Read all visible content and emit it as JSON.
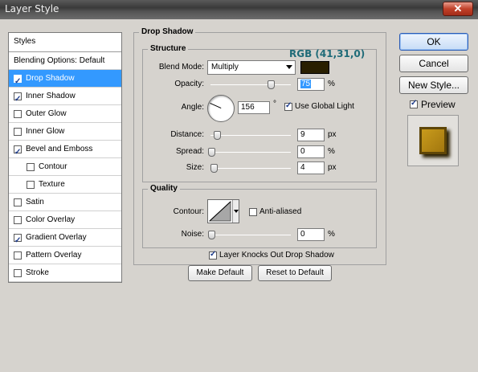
{
  "window": {
    "title": "Layer Style",
    "close_label": "✕"
  },
  "styles_list": {
    "header": "Styles",
    "items": [
      {
        "label": "Blending Options: Default",
        "checkbox": false,
        "checked": false,
        "selected": false,
        "indent": false
      },
      {
        "label": "Drop Shadow",
        "checkbox": true,
        "checked": true,
        "selected": true,
        "indent": false
      },
      {
        "label": "Inner Shadow",
        "checkbox": true,
        "checked": true,
        "selected": false,
        "indent": false
      },
      {
        "label": "Outer Glow",
        "checkbox": true,
        "checked": false,
        "selected": false,
        "indent": false
      },
      {
        "label": "Inner Glow",
        "checkbox": true,
        "checked": false,
        "selected": false,
        "indent": false
      },
      {
        "label": "Bevel and Emboss",
        "checkbox": true,
        "checked": true,
        "selected": false,
        "indent": false
      },
      {
        "label": "Contour",
        "checkbox": true,
        "checked": false,
        "selected": false,
        "indent": true
      },
      {
        "label": "Texture",
        "checkbox": true,
        "checked": false,
        "selected": false,
        "indent": true
      },
      {
        "label": "Satin",
        "checkbox": true,
        "checked": false,
        "selected": false,
        "indent": false
      },
      {
        "label": "Color Overlay",
        "checkbox": true,
        "checked": false,
        "selected": false,
        "indent": false
      },
      {
        "label": "Gradient Overlay",
        "checkbox": true,
        "checked": true,
        "selected": false,
        "indent": false
      },
      {
        "label": "Pattern Overlay",
        "checkbox": true,
        "checked": false,
        "selected": false,
        "indent": false
      },
      {
        "label": "Stroke",
        "checkbox": true,
        "checked": false,
        "selected": false,
        "indent": false
      }
    ]
  },
  "drop_shadow": {
    "title": "Drop Shadow",
    "structure": {
      "title": "Structure",
      "color_annotation": "RGB (41,31,0)",
      "shadow_color": "#291f00",
      "blend_mode_label": "Blend Mode:",
      "blend_mode_value": "Multiply",
      "opacity_label": "Opacity:",
      "opacity_value": "75",
      "opacity_unit": "%",
      "opacity_fraction": 0.75,
      "angle_label": "Angle:",
      "angle_value": "156",
      "angle_unit": "°",
      "use_global_light_label": "Use Global Light",
      "use_global_light_checked": true,
      "distance_label": "Distance:",
      "distance_value": "9",
      "distance_unit": "px",
      "spread_label": "Spread:",
      "spread_value": "0",
      "spread_unit": "%",
      "size_label": "Size:",
      "size_value": "4",
      "size_unit": "px"
    },
    "quality": {
      "title": "Quality",
      "contour_label": "Contour:",
      "anti_aliased_label": "Anti-aliased",
      "anti_aliased_checked": false,
      "noise_label": "Noise:",
      "noise_value": "0",
      "noise_unit": "%"
    },
    "knocks_out_label": "Layer Knocks Out Drop Shadow",
    "knocks_out_checked": true,
    "make_default_label": "Make Default",
    "reset_default_label": "Reset to Default"
  },
  "buttons": {
    "ok_label": "OK",
    "cancel_label": "Cancel",
    "new_style_label": "New Style...",
    "preview_label": "Preview",
    "preview_checked": true
  }
}
